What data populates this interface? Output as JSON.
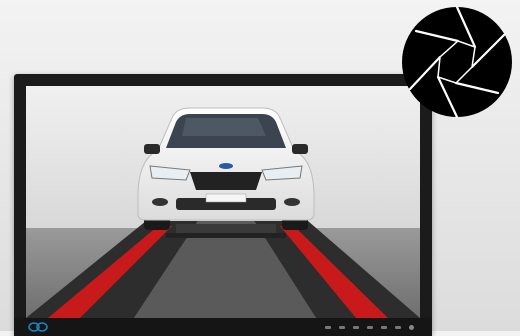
{
  "monitor": {
    "osd_button_count": 7
  },
  "icons": {
    "badge": "camera-shutter-icon",
    "brand": "monitor-brand-logo-icon",
    "vehicle": "car-on-lift-image"
  },
  "colors": {
    "bezel": "#1b1b1b",
    "lift_rail_red": "#c81a1a",
    "badge": "#000000",
    "logo_blue": "#1e88c8"
  }
}
